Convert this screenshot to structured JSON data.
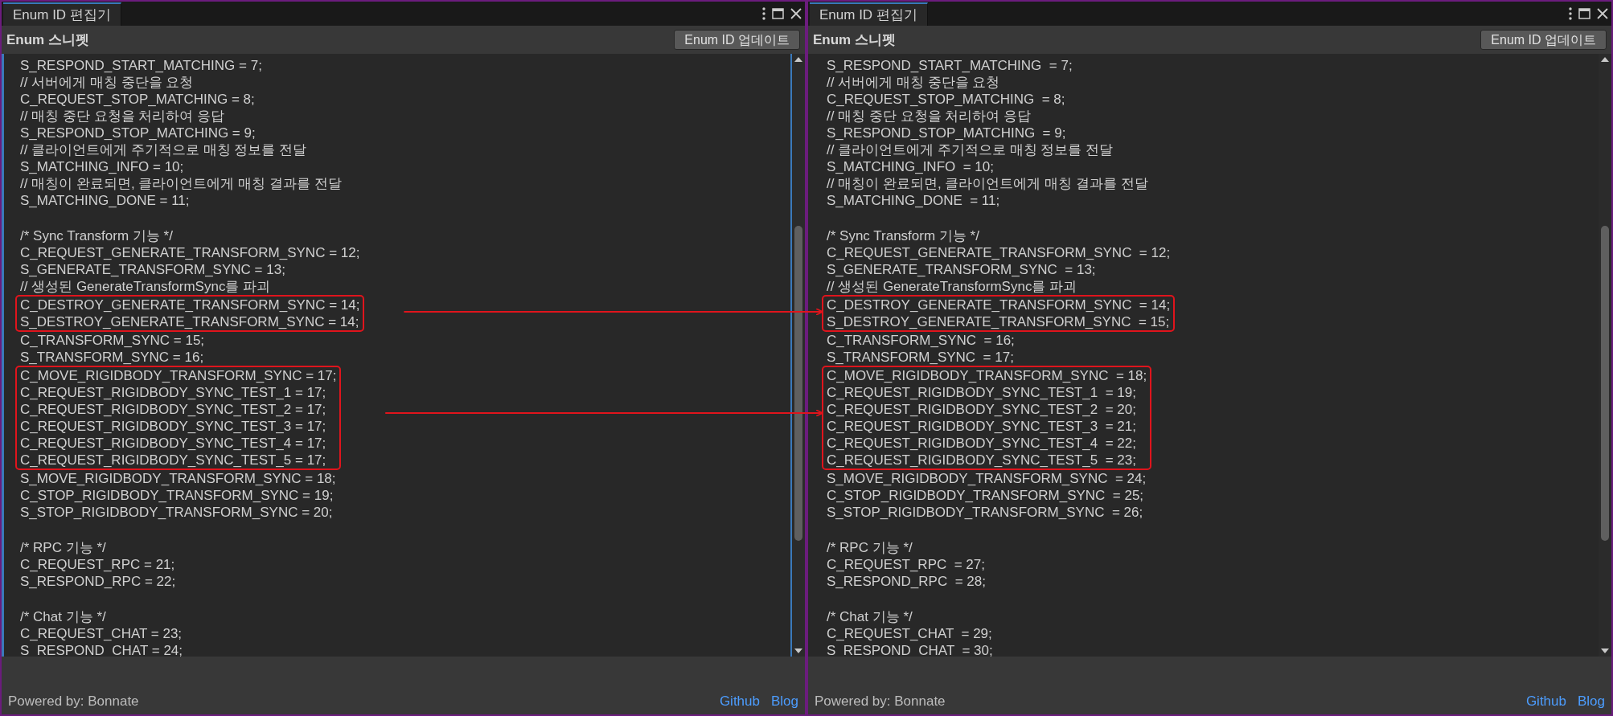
{
  "panels": [
    {
      "tab": {
        "label": "Enum ID 편집기",
        "selected": true
      },
      "section_title": "Enum 스니펫",
      "update_button": "Enum ID 업데이트",
      "focused": true,
      "sections": [
        {
          "blocks": [
            {
              "highlighted": false,
              "lines": [
                "S_RESPOND_START_MATCHING = 7;",
                "// 서버에게 매칭 중단을 요청",
                "C_REQUEST_STOP_MATCHING = 8;",
                "// 매칭 중단 요청을 처리하여 응답",
                "S_RESPOND_STOP_MATCHING = 9;",
                "// 클라이언트에게 주기적으로 매칭 정보를 전달",
                "S_MATCHING_INFO = 10;",
                "// 매칭이 완료되면, 클라이언트에게 매칭 결과를 전달",
                "S_MATCHING_DONE = 11;"
              ]
            }
          ]
        },
        {
          "blocks": [
            {
              "highlighted": false,
              "lines": [
                "/* Sync Transform 기능 */",
                "C_REQUEST_GENERATE_TRANSFORM_SYNC = 12;",
                "S_GENERATE_TRANSFORM_SYNC = 13;",
                "// 생성된 GenerateTransformSync를 파괴"
              ]
            },
            {
              "highlighted": true,
              "lines": [
                "C_DESTROY_GENERATE_TRANSFORM_SYNC = 14;",
                "S_DESTROY_GENERATE_TRANSFORM_SYNC = 14;"
              ]
            },
            {
              "highlighted": false,
              "lines": [
                "C_TRANSFORM_SYNC = 15;",
                "S_TRANSFORM_SYNC = 16;"
              ]
            },
            {
              "highlighted": true,
              "lines": [
                "C_MOVE_RIGIDBODY_TRANSFORM_SYNC = 17;",
                "C_REQUEST_RIGIDBODY_SYNC_TEST_1 = 17;",
                "C_REQUEST_RIGIDBODY_SYNC_TEST_2 = 17;",
                "C_REQUEST_RIGIDBODY_SYNC_TEST_3 = 17;",
                "C_REQUEST_RIGIDBODY_SYNC_TEST_4 = 17;",
                "C_REQUEST_RIGIDBODY_SYNC_TEST_5 = 17;"
              ]
            },
            {
              "highlighted": false,
              "lines": [
                "S_MOVE_RIGIDBODY_TRANSFORM_SYNC = 18;",
                "C_STOP_RIGIDBODY_TRANSFORM_SYNC = 19;",
                "S_STOP_RIGIDBODY_TRANSFORM_SYNC = 20;"
              ]
            }
          ]
        },
        {
          "blocks": [
            {
              "highlighted": false,
              "lines": [
                "/* RPC 기능 */",
                "C_REQUEST_RPC = 21;",
                "S_RESPOND_RPC = 22;"
              ]
            }
          ]
        },
        {
          "blocks": [
            {
              "highlighted": false,
              "lines": [
                "/* Chat 기능 */",
                "C_REQUEST_CHAT = 23;",
                "S_RESPOND_CHAT = 24;"
              ]
            }
          ]
        }
      ],
      "footer_text": "Powered by: Bonnate",
      "links": [
        "Github",
        "Blog"
      ]
    },
    {
      "tab": {
        "label": "Enum ID 편집기",
        "selected": true
      },
      "section_title": "Enum 스니펫",
      "update_button": "Enum ID 업데이트",
      "focused": false,
      "sections": [
        {
          "blocks": [
            {
              "highlighted": false,
              "lines": [
                "S_RESPOND_START_MATCHING  = 7;",
                "// 서버에게 매칭 중단을 요청",
                "C_REQUEST_STOP_MATCHING  = 8;",
                "// 매칭 중단 요청을 처리하여 응답",
                "S_RESPOND_STOP_MATCHING  = 9;",
                "// 클라이언트에게 주기적으로 매칭 정보를 전달",
                "S_MATCHING_INFO  = 10;",
                "// 매칭이 완료되면, 클라이언트에게 매칭 결과를 전달",
                "S_MATCHING_DONE  = 11;"
              ]
            }
          ]
        },
        {
          "blocks": [
            {
              "highlighted": false,
              "lines": [
                "/* Sync Transform 기능 */",
                "C_REQUEST_GENERATE_TRANSFORM_SYNC  = 12;",
                "S_GENERATE_TRANSFORM_SYNC  = 13;",
                "// 생성된 GenerateTransformSync를 파괴"
              ]
            },
            {
              "highlighted": true,
              "lines": [
                "C_DESTROY_GENERATE_TRANSFORM_SYNC  = 14;",
                "S_DESTROY_GENERATE_TRANSFORM_SYNC  = 15;"
              ]
            },
            {
              "highlighted": false,
              "lines": [
                "C_TRANSFORM_SYNC  = 16;",
                "S_TRANSFORM_SYNC  = 17;"
              ]
            },
            {
              "highlighted": true,
              "lines": [
                "C_MOVE_RIGIDBODY_TRANSFORM_SYNC  = 18;",
                "C_REQUEST_RIGIDBODY_SYNC_TEST_1  = 19;",
                "C_REQUEST_RIGIDBODY_SYNC_TEST_2  = 20;",
                "C_REQUEST_RIGIDBODY_SYNC_TEST_3  = 21;",
                "C_REQUEST_RIGIDBODY_SYNC_TEST_4  = 22;",
                "C_REQUEST_RIGIDBODY_SYNC_TEST_5  = 23;"
              ]
            },
            {
              "highlighted": false,
              "lines": [
                "S_MOVE_RIGIDBODY_TRANSFORM_SYNC  = 24;",
                "C_STOP_RIGIDBODY_TRANSFORM_SYNC  = 25;",
                "S_STOP_RIGIDBODY_TRANSFORM_SYNC  = 26;"
              ]
            }
          ]
        },
        {
          "blocks": [
            {
              "highlighted": false,
              "lines": [
                "/* RPC 기능 */",
                "C_REQUEST_RPC  = 27;",
                "S_RESPOND_RPC  = 28;"
              ]
            }
          ]
        },
        {
          "blocks": [
            {
              "highlighted": false,
              "lines": [
                "/* Chat 기능 */",
                "C_REQUEST_CHAT  = 29;",
                "S_RESPOND_CHAT  = 30;"
              ]
            }
          ]
        }
      ],
      "footer_text": "Powered by: Bonnate",
      "links": [
        "Github",
        "Blog"
      ]
    }
  ]
}
